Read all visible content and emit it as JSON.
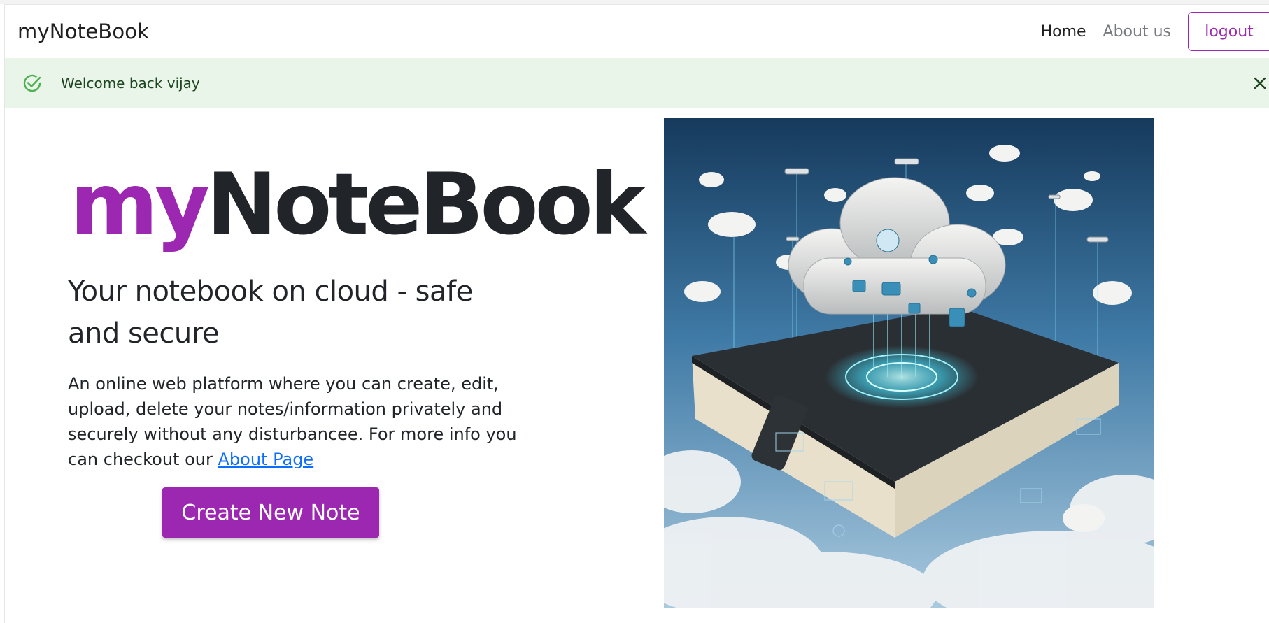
{
  "navbar": {
    "brand": "myNoteBook",
    "links": [
      {
        "label": "Home",
        "active": true
      },
      {
        "label": "About us",
        "active": false
      }
    ],
    "logout_label": "logout"
  },
  "alert": {
    "message": "Welcome back vijay",
    "icon": "check-circle-icon",
    "close_icon": "close-icon"
  },
  "hero": {
    "title_accent": "my",
    "title_rest": "NoteBook",
    "subtitle": "Your notebook on cloud - safe and secure",
    "description": "An online web platform where you can create, edit, upload, delete your notes/information privately and securely without any disturbancee. For more info you can checkout our",
    "about_link": "About Page",
    "cta_label": "Create New Note",
    "image": "cloud-notebook-illustration"
  },
  "colors": {
    "accent": "#9c27b0",
    "link": "#0d6efd",
    "alert_bg": "#eaf5ea",
    "alert_text": "#1e4620"
  }
}
